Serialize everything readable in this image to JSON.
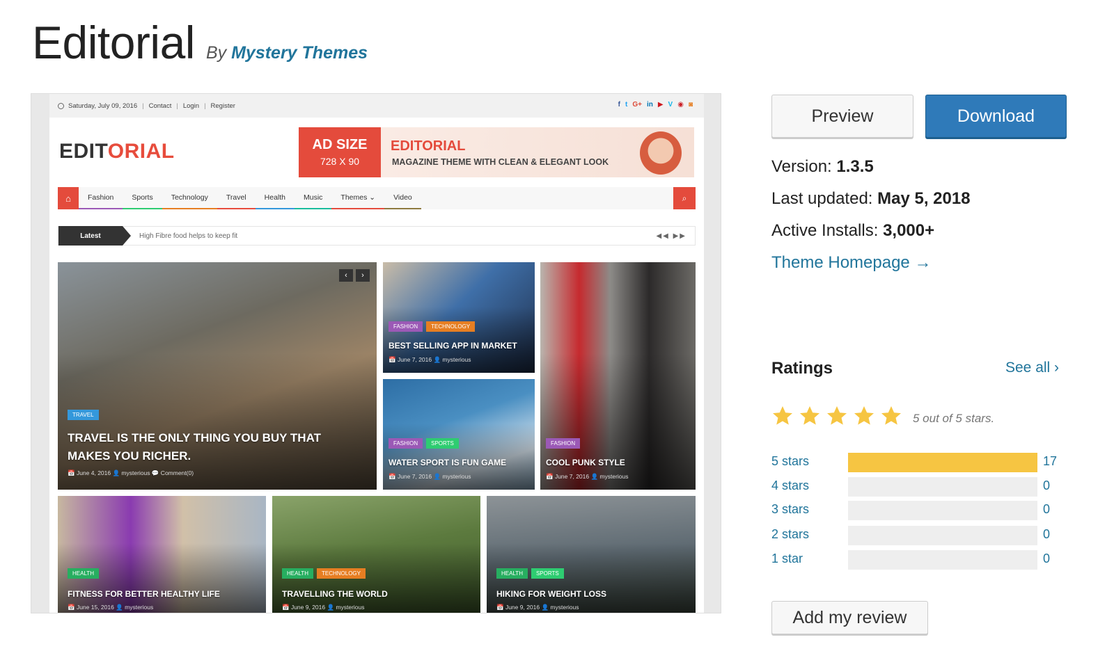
{
  "header": {
    "title": "Editorial",
    "by_label": "By",
    "author": "Mystery Themes"
  },
  "screenshot": {
    "topbar": {
      "date": "Saturday, July 09, 2016",
      "links": [
        "Contact",
        "Login",
        "Register"
      ],
      "social": [
        "f",
        "t",
        "G+",
        "in",
        "▶",
        "V",
        "◉",
        "◙"
      ]
    },
    "logo": {
      "part1": "EDIT",
      "part2": "ORIAL"
    },
    "ad": {
      "size_label": "AD SIZE",
      "dims": "728 X 90",
      "title": "EDITORIAL",
      "subtitle": "MAGAZINE THEME WITH CLEAN & ELEGANT LOOK"
    },
    "nav": [
      "Fashion",
      "Sports",
      "Technology",
      "Travel",
      "Health",
      "Music",
      "Themes ⌄",
      "Video"
    ],
    "nav_colors": [
      "#9b59b6",
      "#2ecc71",
      "#e67e22",
      "#e74c3c",
      "#3498db",
      "#1abc9c",
      "#e44b3c",
      "#8e7a3f"
    ],
    "ticker": {
      "label": "Latest",
      "text": "High Fibre food helps to keep fit",
      "controls": "◀◀ ▶▶"
    },
    "tiles": [
      {
        "tags": [
          "TRAVEL"
        ],
        "title": "TRAVEL IS THE ONLY THING YOU BUY THAT MAKES YOU RICHER.",
        "meta": "📅 June 4, 2016   👤 mysterious   💬 Comment(0)"
      },
      {
        "tags": [
          "FASHION",
          "TECHNOLOGY"
        ],
        "title": "BEST SELLING APP IN MARKET",
        "meta": "📅 June 7, 2016   👤 mysterious"
      },
      {
        "tags": [
          "FASHION",
          "SPORTS"
        ],
        "title": "WATER SPORT IS FUN GAME",
        "meta": "📅 June 7, 2016   👤 mysterious"
      },
      {
        "tags": [
          "FASHION"
        ],
        "title": "COOL PUNK STYLE",
        "meta": "📅 June 7, 2016   👤 mysterious"
      },
      {
        "tags": [
          "HEALTH"
        ],
        "title": "FITNESS FOR BETTER HEALTHY LIFE",
        "meta": "📅 June 15, 2016   👤 mysterious"
      },
      {
        "tags": [
          "HEALTH",
          "TECHNOLOGY"
        ],
        "title": "TRAVELLING THE WORLD",
        "meta": "📅 June 9, 2016   👤 mysterious"
      },
      {
        "tags": [
          "HEALTH",
          "SPORTS"
        ],
        "title": "HIKING FOR WEIGHT LOSS",
        "meta": "📅 June 9, 2016   👤 mysterious"
      }
    ]
  },
  "actions": {
    "preview": "Preview",
    "download": "Download",
    "add_review": "Add my review"
  },
  "info": {
    "version_label": "Version:",
    "version": "1.3.5",
    "updated_label": "Last updated:",
    "updated": "May 5, 2018",
    "installs_label": "Active Installs:",
    "installs": "3,000+",
    "homepage": "Theme Homepage →"
  },
  "ratings": {
    "title": "Ratings",
    "see_all": "See all ›",
    "summary": "5 out of 5 stars.",
    "stars_filled": 5,
    "rows": [
      {
        "label": "5 stars",
        "count": "17",
        "fraction": 1.0
      },
      {
        "label": "4 stars",
        "count": "0",
        "fraction": 0
      },
      {
        "label": "3 stars",
        "count": "0",
        "fraction": 0
      },
      {
        "label": "2 stars",
        "count": "0",
        "fraction": 0
      },
      {
        "label": "1 star",
        "count": "0",
        "fraction": 0
      }
    ]
  },
  "colors": {
    "accent_link": "#21759b",
    "download_bg": "#2f7ab9",
    "star": "#f6c542",
    "brand_red": "#e44b3c"
  }
}
